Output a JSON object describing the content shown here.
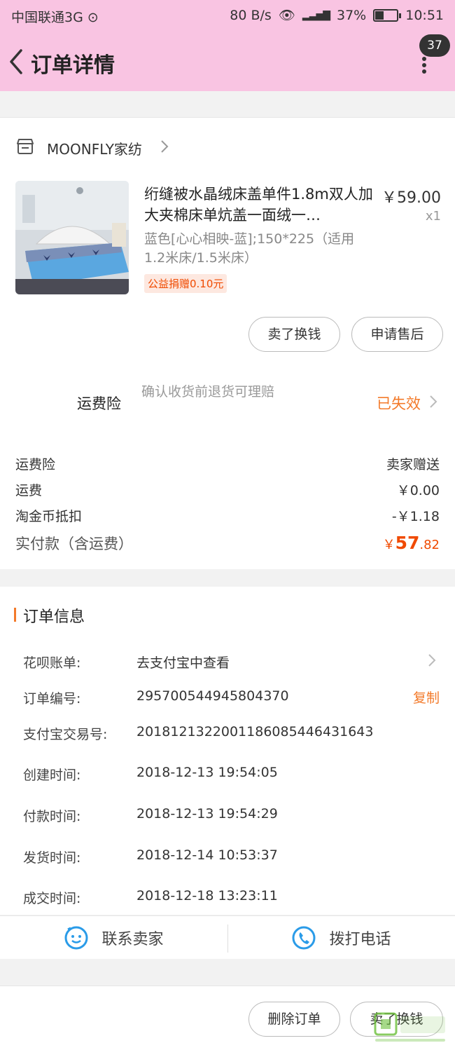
{
  "status_bar": {
    "carrier": "中国联通3G",
    "speed": "80 B/s",
    "battery": "37%",
    "battery_level": 0.37,
    "time": "10:51"
  },
  "header": {
    "title": "订单详情",
    "badge": "37",
    "background": "#f9c4e2"
  },
  "store": {
    "name": "MOONFLY家纺"
  },
  "product": {
    "title": "绗缝被水晶绒床盖单件1.8m双人加大夹棉床单炕盖一面绒一…",
    "price": "￥59.00",
    "quantity": "x1",
    "spec": "蓝色[心心相映-蓝];150*225（适用1.2米床/1.5米床）",
    "donate_tag": "公益捐赠0.10元"
  },
  "actions": {
    "sell": "卖了换钱",
    "after_sale": "申请售后",
    "delete": "删除订单",
    "sell_bottom": "卖了换钱"
  },
  "insurance": {
    "label": "运费险",
    "desc": "确认收货前退货可理赔",
    "status": "已失效"
  },
  "fees": {
    "insurance_label": "运费险",
    "insurance_value": "卖家赠送",
    "shipping_label": "运费",
    "shipping_value": "￥0.00",
    "coin_label": "淘金币抵扣",
    "coin_value": "-￥1.18",
    "total_label": "实付款（含运费）",
    "total_symbol": "￥",
    "total_int": "57",
    "total_dec": ".82"
  },
  "order_info": {
    "title": "订单信息",
    "copy": "复制",
    "rows": [
      {
        "k": "花呗账单:",
        "v": "去支付宝中查看"
      },
      {
        "k": "订单编号:",
        "v": "295700544945804370"
      },
      {
        "k": "支付宝交易号:",
        "v": "2018121322001186085446431643"
      },
      {
        "k": "创建时间:",
        "v": "2018-12-13 19:54:05"
      },
      {
        "k": "付款时间:",
        "v": "2018-12-13 19:54:29"
      },
      {
        "k": "发货时间:",
        "v": "2018-12-14 10:53:37"
      },
      {
        "k": "成交时间:",
        "v": "2018-12-18 13:23:11"
      }
    ]
  },
  "contact": {
    "seller": "联系卖家",
    "phone": "拨打电话"
  },
  "colors": {
    "accent": "#f37a2a",
    "price_red": "#f04a00",
    "icon_blue": "#2a9be8"
  }
}
